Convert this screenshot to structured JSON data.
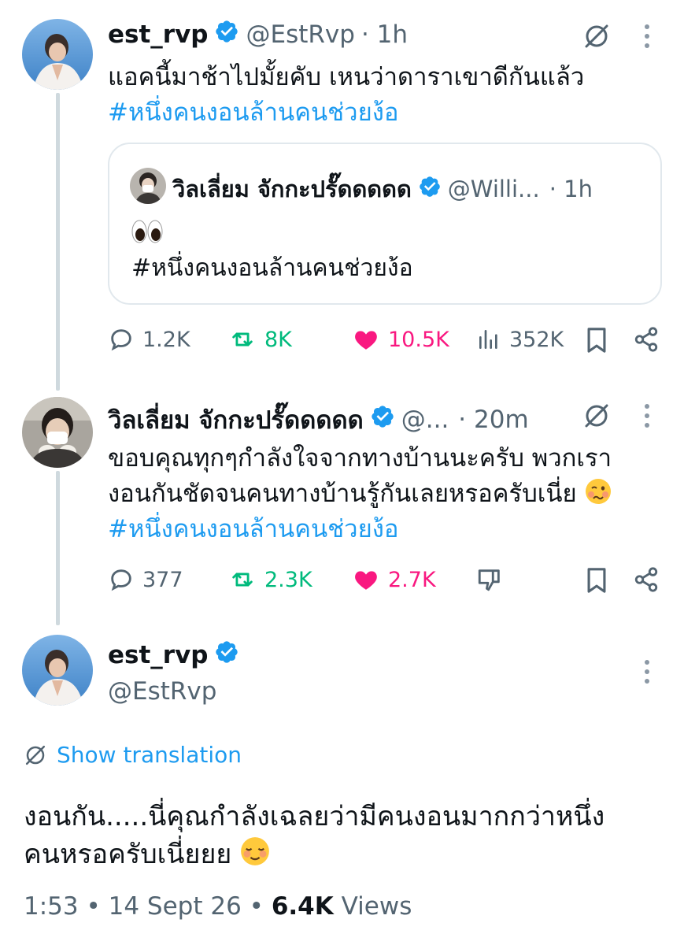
{
  "tweet1": {
    "name": "est_rvp",
    "handle": "@EstRvp",
    "time": "· 1h",
    "text_line1": "แอคนี้มาช้าไปมั้ยคับ เหนว่าดาราเขาดีกันแล้ว",
    "hashtag": "#หนึ่งคนงอนล้านคนช่วยง้อ",
    "quote": {
      "name": "วิลเลี่ยม จักกะปรั๊ดดดดด",
      "handle": "@Willi...",
      "time": "· 1h",
      "hashtag": "#หนึ่งคนงอนล้านคนช่วยง้อ",
      "emoji": "eyes"
    },
    "actions": {
      "replies": "1.2K",
      "reposts": "8K",
      "likes": "10.5K",
      "views": "352K"
    }
  },
  "tweet2": {
    "name": "วิลเลี่ยม จักกะปรั๊ดดดดด",
    "handle": "@...",
    "time": "· 20m",
    "text_line1": "ขอบคุณทุกๆกำลังใจจากทางบ้านนะครับ พวกเรา",
    "text_line2": "งอนกันชัดจนคนทางบ้านรู้กันเลยหรอครับเนี่ย",
    "hashtag": "#หนึ่งคนงอนล้านคนช่วยง้อ",
    "actions": {
      "replies": "377",
      "reposts": "2.3K",
      "likes": "2.7K"
    }
  },
  "main_tweet": {
    "name": "est_rvp",
    "handle": "@EstRvp",
    "translate_label": "Show translation",
    "text_line1": "งอนกัน.....นี่คุณกำลังเฉลยว่ามีคนงอนมากกว่าหนึ่ง",
    "text_line2": "คนหรอครับเนี่ยยย",
    "time": "1:53",
    "date": "14 Sept 26",
    "views_count": "6.4K",
    "views_label": "Views"
  },
  "colors": {
    "accent": "#1d9bf0",
    "repost": "#00ba7c",
    "like": "#f91880",
    "secondary_text": "#536471"
  }
}
